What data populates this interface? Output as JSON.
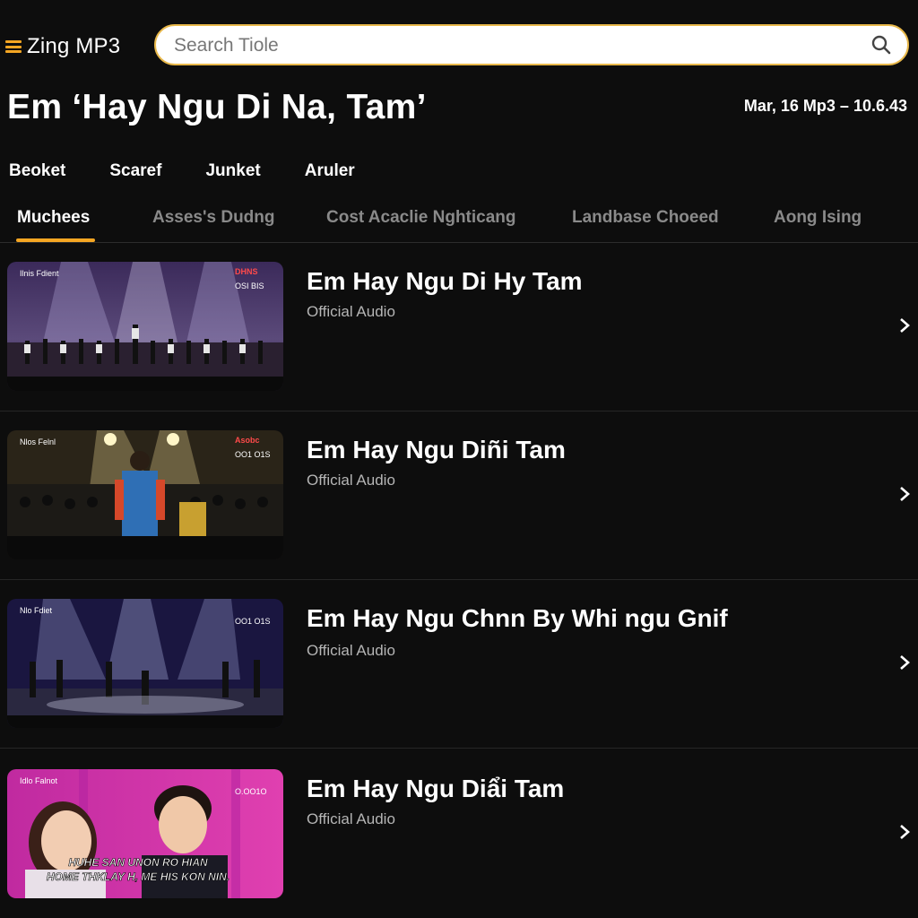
{
  "app": {
    "name": "Zing MP3"
  },
  "search": {
    "placeholder": "Search Tiole"
  },
  "header": {
    "title": "Em ‘Hay Ngu Di Na, Tam’",
    "meta": "Mar, 16 Mp3  –  10.6.43"
  },
  "subnav": [
    "Beoket",
    "Scaref",
    "Junket",
    "Aruler"
  ],
  "tabs": [
    {
      "label": "Muchees",
      "active": true
    },
    {
      "label": "Asses's Dudng",
      "active": false
    },
    {
      "label": "Cost Acaclie Nghticang",
      "active": false
    },
    {
      "label": "Landbase Choeed",
      "active": false
    },
    {
      "label": "Aong Ising",
      "active": false
    }
  ],
  "songs": [
    {
      "title": "Em Hay Ngu Di Hy Tam",
      "subtitle": "Official Audio",
      "thumb": {
        "channel": "Ilnis Fdient",
        "badge": "DHNS",
        "code": "OSI BIS"
      }
    },
    {
      "title": "Em Hay Ngu Diñi Tam",
      "subtitle": "Official Audio",
      "thumb": {
        "channel": "Nlos Felnl",
        "badge": "Asobc",
        "code": "OO1 O1S"
      }
    },
    {
      "title": "Em Hay Ngu Chnn By Whi ngu Gnif",
      "subtitle": "Official Audio",
      "thumb": {
        "channel": "Nlo Fdiet",
        "badge": "",
        "code": "OO1 O1S"
      }
    },
    {
      "title": "Em Hay Ngu Diẩi Tam",
      "subtitle": "Official Audio",
      "thumb": {
        "channel": "Idlo Falnot",
        "badge": "",
        "code": "O.OO1O",
        "caption_line1": "HUHE SAN UNON RO HIAN",
        "caption_line2": "HOME THKLAY H, ME HIS KON NIN."
      }
    }
  ]
}
